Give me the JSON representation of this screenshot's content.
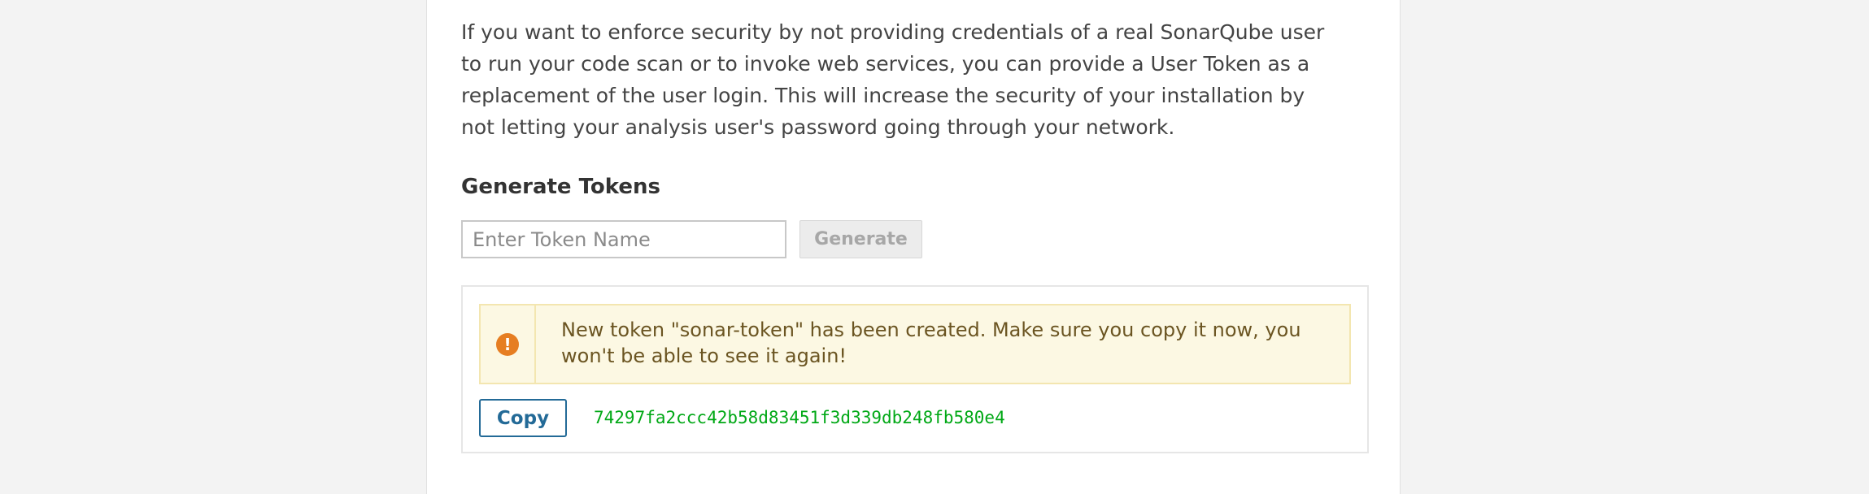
{
  "intro": {
    "text": "If you want to enforce security by not providing credentials of a real SonarQube user to run your code scan or to invoke web services, you can provide a User Token as a replacement of the user login. This will increase the security of your installation by not letting your analysis user's password going through your network."
  },
  "generate": {
    "title": "Generate Tokens",
    "input_placeholder": "Enter Token Name",
    "input_value": "",
    "button_label": "Generate"
  },
  "new_token": {
    "alert_icon": "exclamation-circle-icon",
    "alert_message": "New token \"sonar-token\" has been created. Make sure you copy it now, you won't be able to see it again!",
    "copy_label": "Copy",
    "token": "74297fa2ccc42b58d83451f3d339db248fb580e4"
  },
  "colors": {
    "page_background": "#f3f3f3",
    "warning_background": "#fcf8e3",
    "warning_icon": "#e67e22",
    "copy_button": "#236a97",
    "token_text": "#00a815"
  }
}
